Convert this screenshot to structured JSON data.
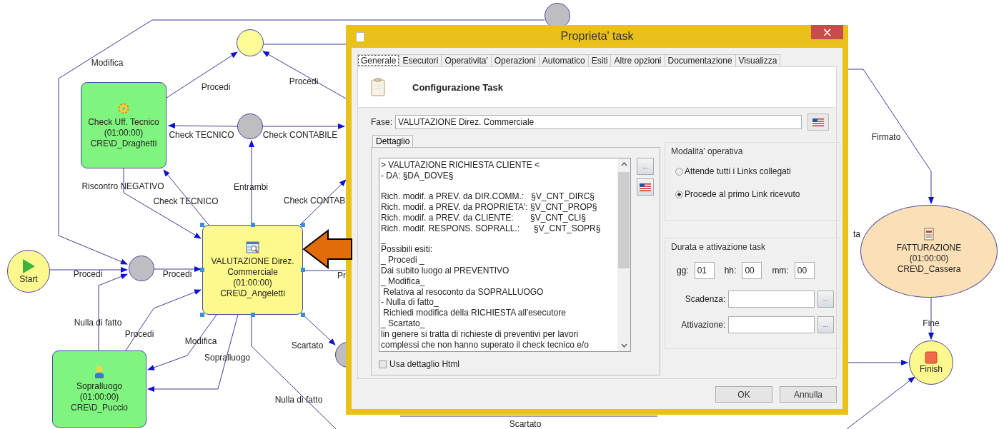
{
  "diagram": {
    "nodes": [
      {
        "kind": "start",
        "label": "Start",
        "color": "#fcf88e"
      },
      {
        "kind": "gateway",
        "color": "#bdbdc2"
      },
      {
        "kind": "gateway",
        "color": "#bdbdc2"
      },
      {
        "kind": "gateway",
        "color": "#fdfb96"
      },
      {
        "kind": "gateway",
        "color": "#bdbdc2"
      },
      {
        "kind": "gateway",
        "color": "#bdbdc2"
      },
      {
        "kind": "task",
        "name": "Check Uff. Tecnico",
        "duration": "(01:00:00)",
        "owner": "CRE\\D_Draghetti",
        "color": "#7ff57f",
        "selected": false
      },
      {
        "kind": "task",
        "name": "VALUTAZIONE Direz. Commerciale",
        "duration": "(01:00:00)",
        "owner": "CRE\\D_Angeletti",
        "color": "#fdf98c",
        "selected": true
      },
      {
        "kind": "task",
        "name": "Sopralluogo",
        "duration": "(01:00:00)",
        "owner": "CRE\\D_Puccio",
        "color": "#7ff57f",
        "selected": false
      },
      {
        "kind": "ellipse",
        "name": "FATTURAZIONE",
        "duration": "(01:00:00)",
        "owner": "CRE\\D_Cassera",
        "color": "#fbdfb6",
        "selected": false
      },
      {
        "kind": "finish",
        "label": "Finish",
        "color": "#fcf88e"
      }
    ],
    "edge_labels": [
      "Modifica",
      "Procedi",
      "Procedi",
      "Check TECNICO",
      "Check CONTABILE",
      "Riscontro NEGATIVO",
      "Check TECNICO",
      "Entrambi",
      "Check CONTAB",
      "Procedi",
      "Procedi",
      "Pr",
      "Nulla di fatto",
      "Procedi",
      "Modifica",
      "Sopralluogo",
      "Scartato",
      "Nulla di fatto",
      "Scartato",
      "Firmato",
      "Fine",
      "ta"
    ]
  },
  "dialog": {
    "title": "Proprieta' task",
    "close": "×",
    "tabs": [
      {
        "label": "Generale",
        "selected": true
      },
      {
        "label": "Esecutori",
        "selected": false
      },
      {
        "label": "Operativita'",
        "selected": false
      },
      {
        "label": "Operazioni",
        "selected": false
      },
      {
        "label": "Automatico",
        "selected": false
      },
      {
        "label": "Esiti",
        "selected": false
      },
      {
        "label": "Altre opzioni",
        "selected": false
      },
      {
        "label": "Documentazione",
        "selected": false
      },
      {
        "label": "Visualizza",
        "selected": false
      }
    ],
    "header": "Configurazione Task",
    "fase": {
      "label": "Fase:",
      "value": "VALUTAZIONE Direz. Commerciale"
    },
    "detail": {
      "tab": "Dettaglio",
      "text": "> VALUTAZIONE RICHIESTA CLIENTE <\n- DA: §DA_DOVE§\n\nRich. modif. a PREV. da DIR.COMM.:   §V_CNT_DIRC§\nRich. modif. a PREV. da PROPRIETA': §V_CNT_PROP§\nRich. modif. a PREV. da CLIENTE:       §V_CNT_CLI§\nRich. modif. RESPONS. SOPRALL.:      §V_CNT_SOPR§\n_\nPossibili esiti:\n_ Procedi _\nDai subito luogo al PREVENTIVO\n_ Modifica_\n Relativa al resoconto da SOPRALLUOGO\n- Nulla di fatto_\n Richiedi modifica della RICHIESTA all'esecutore\n_ Scartato_\nlin genere si tratta di richieste di preventivi per lavori\ncomplessi che non hanno superato il check tecnico e/o",
      "browse": "...",
      "html_option": {
        "label": "Usa dettaglio Html",
        "checked": false
      }
    },
    "mode": {
      "title": "Modalita' operativa",
      "options": [
        {
          "label": "Attende tutti i Links collegati",
          "selected": false
        },
        {
          "label": "Procede al primo Link ricevuto",
          "selected": true
        }
      ]
    },
    "duration": {
      "title": "Durata e attivazione task",
      "fields": [
        {
          "label": "gg:",
          "value": "01"
        },
        {
          "label": "hh:",
          "value": "00"
        },
        {
          "label": "mm:",
          "value": "00"
        }
      ],
      "dates": [
        {
          "label": "Scadenza:",
          "button": "..."
        },
        {
          "label": "Attivazione:",
          "button": "..."
        }
      ]
    },
    "buttons": [
      "OK",
      "Annulla"
    ]
  }
}
